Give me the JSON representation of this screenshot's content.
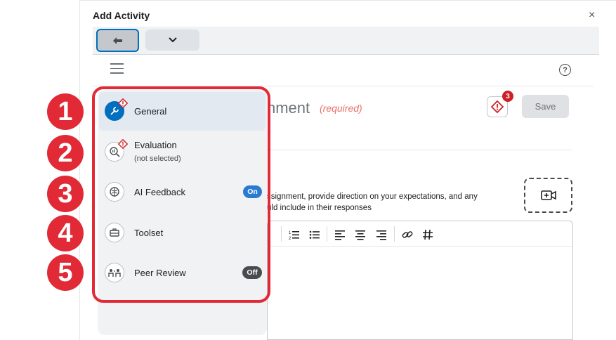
{
  "dialog": {
    "title": "Add Activity",
    "close_glyph": "×"
  },
  "header": {
    "heading_fragment": "nment",
    "required_label": "(required)",
    "alert_count": "3",
    "save_label": "Save"
  },
  "instructions": {
    "line1": "ssignment, provide direction on your expectations, and any",
    "line2": "uld include in their responses"
  },
  "nav": {
    "items": [
      {
        "label": "General",
        "sublabel": "",
        "icon": "wrench-icon",
        "badge": "",
        "warning": true,
        "active": true
      },
      {
        "label": "Evaluation",
        "sublabel": "(not selected)",
        "icon": "magnify-chart-icon",
        "badge": "",
        "warning": true,
        "active": false
      },
      {
        "label": "AI Feedback",
        "sublabel": "",
        "icon": "brain-icon",
        "badge": "On",
        "warning": false,
        "active": false
      },
      {
        "label": "Toolset",
        "sublabel": "",
        "icon": "toolbox-icon",
        "badge": "",
        "warning": false,
        "active": false
      },
      {
        "label": "Peer Review",
        "sublabel": "",
        "icon": "peers-icon",
        "badge": "Off",
        "warning": false,
        "active": false
      }
    ]
  },
  "callouts": [
    "1",
    "2",
    "3",
    "4",
    "5"
  ],
  "colors": {
    "accent": "#006fbf",
    "highlight": "#e12a36",
    "on_badge": "#2a7ad1",
    "off_badge": "#494c4e"
  }
}
